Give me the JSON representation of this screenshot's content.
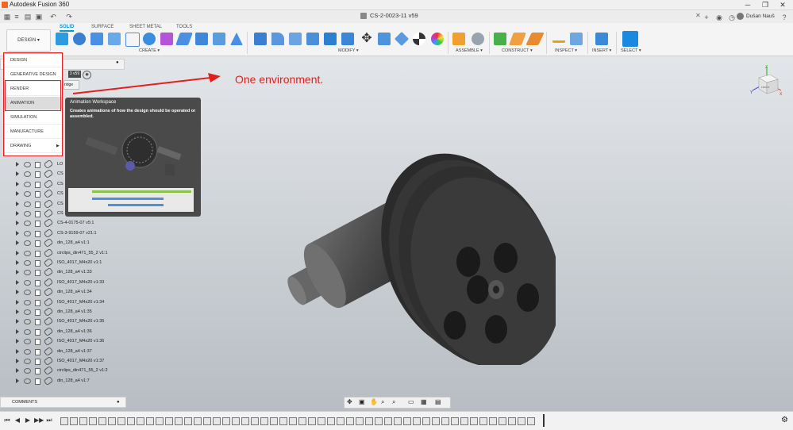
{
  "window": {
    "title": "Autodesk Fusion 360",
    "controls": [
      "─",
      "❐",
      "✕"
    ]
  },
  "document": {
    "tab": "CS-2-0023-11 v59",
    "close": "✕",
    "user": "Dušan Nauš"
  },
  "ribbon": {
    "tabs": [
      "SOLID",
      "SURFACE",
      "SHEET METAL",
      "TOOLS"
    ],
    "active_tab": "SOLID",
    "workspace_button": "DESIGN ▾",
    "groups": [
      "CREATE ▾",
      "MODIFY ▾",
      "ASSEMBLE ▾",
      "CONSTRUCT ▾",
      "INSPECT ▾",
      "INSERT ▾",
      "SELECT ▾"
    ]
  },
  "workspace_menu": {
    "items": [
      "DESIGN",
      "GENERATIVE DESIGN",
      "RENDER",
      "ANIMATION",
      "SIMULATION",
      "MANUFACTURE",
      "DRAWING"
    ],
    "highlighted": "ANIMATION",
    "drawing_arrow": "▶"
  },
  "tooltip": {
    "title": "Animation Workspace",
    "description": "Creates animations of how the design should be operated or assembled."
  },
  "annotation": {
    "text": "One environment.",
    "color": "#e02020"
  },
  "browser": {
    "partial_tab_1": "3 v59",
    "partial_tab_2": "ridge",
    "partial_rows": [
      "LO",
      "CS",
      "CS",
      "CS",
      "CS",
      "CS"
    ],
    "items": [
      "CS-4-0175-07 v5:1",
      "CS-3-9159-07 v21:1",
      "din_128_a4 v1:1",
      "circlips_din471_55_2 v1:1",
      "ISO_4017_M4x20 v1:1",
      "din_128_a4 v1:33",
      "ISO_4017_M4x20 v1:33",
      "din_128_a4 v1:34",
      "ISO_4017_M4x20 v1:34",
      "din_128_a4 v1:35",
      "ISO_4017_M4x20 v1:35",
      "din_128_a4 v1:36",
      "ISO_4017_M4x20 v1:36",
      "din_128_a4 v1:37",
      "ISO_4017_M4x20 v1:37",
      "circlips_din471_55_2 v1:2",
      "din_128_a4 v1:7"
    ]
  },
  "comments": {
    "label": "COMMENTS"
  },
  "viewcube": {
    "face": "FRONT",
    "axes": [
      "Z",
      "Y",
      "X"
    ]
  },
  "timeline": {
    "controls": [
      "⏮",
      "◀",
      "▶",
      "▶▶",
      "⏭"
    ]
  }
}
